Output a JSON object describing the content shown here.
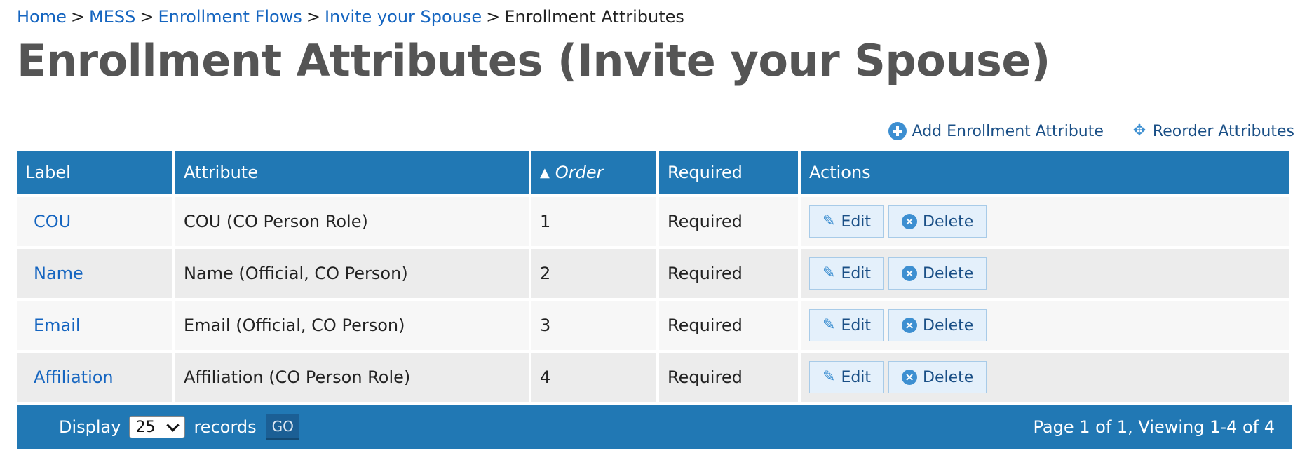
{
  "breadcrumb": {
    "items": [
      "Home",
      "MESS",
      "Enrollment Flows",
      "Invite your Spouse"
    ],
    "separator": ">",
    "current": "Enrollment Attributes"
  },
  "page_title": "Enrollment Attributes (Invite your Spouse)",
  "actions": {
    "add_label": "Add Enrollment Attribute",
    "add_icon": "plus-circle-icon",
    "reorder_label": "Reorder Attributes",
    "reorder_icon": "move-icon"
  },
  "table": {
    "headers": {
      "label": "Label",
      "attribute": "Attribute",
      "order_sort_indicator": "▲",
      "order": "Order",
      "required": "Required",
      "actions": "Actions"
    },
    "rows": [
      {
        "label": "COU",
        "attribute": "COU (CO Person Role)",
        "order": "1",
        "required": "Required"
      },
      {
        "label": "Name",
        "attribute": "Name (Official, CO Person)",
        "order": "2",
        "required": "Required"
      },
      {
        "label": "Email",
        "attribute": "Email (Official, CO Person)",
        "order": "3",
        "required": "Required"
      },
      {
        "label": "Affiliation",
        "attribute": "Affiliation (CO Person Role)",
        "order": "4",
        "required": "Required"
      }
    ],
    "row_actions": {
      "edit_label": "Edit",
      "edit_icon": "pencil-icon",
      "delete_label": "Delete",
      "delete_icon": "x-circle-icon"
    }
  },
  "pagination": {
    "display_label": "Display",
    "records_value": "25",
    "records_label": "records",
    "go_label": "GO",
    "status": "Page 1 of 1, Viewing 1-4 of 4"
  },
  "colors": {
    "header_blue": "#2178b4",
    "link_blue": "#1565c0",
    "title_gray": "#555555"
  }
}
